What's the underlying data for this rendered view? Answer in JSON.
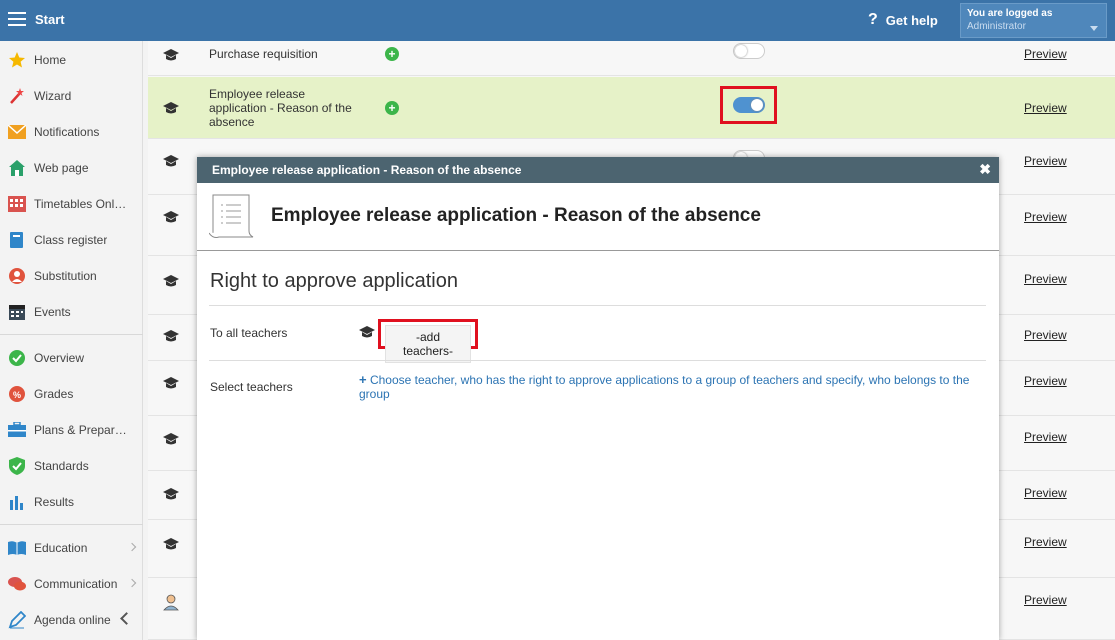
{
  "topbar": {
    "start_label": "Start",
    "help_label": "Get help",
    "login_line1": "You are logged as",
    "login_user": "Administrator"
  },
  "sidebar": {
    "items": [
      {
        "label": "Home",
        "icon": "star-icon"
      },
      {
        "label": "Wizard",
        "icon": "wand-icon"
      },
      {
        "label": "Notifications",
        "icon": "envelope-icon"
      },
      {
        "label": "Web page",
        "icon": "house-icon"
      },
      {
        "label": "Timetables Onl…",
        "icon": "timetable-icon"
      },
      {
        "label": "Class register",
        "icon": "book-icon"
      },
      {
        "label": "Substitution",
        "icon": "person-icon"
      },
      {
        "label": "Events",
        "icon": "calendar-icon"
      },
      {
        "label": "Overview",
        "icon": "check-circle-icon"
      },
      {
        "label": "Grades",
        "icon": "grades-icon"
      },
      {
        "label": "Plans & Prepar…",
        "icon": "briefcase-icon"
      },
      {
        "label": "Standards",
        "icon": "shield-icon"
      },
      {
        "label": "Results",
        "icon": "bar-chart-icon"
      },
      {
        "label": "Education",
        "icon": "open-book-icon"
      },
      {
        "label": "Communication",
        "icon": "chat-icon"
      },
      {
        "label": "Agenda online",
        "icon": "pen-icon"
      }
    ]
  },
  "list": {
    "preview_label": "Preview",
    "rows": [
      {
        "label": "Purchase requisition",
        "toggle": "off"
      },
      {
        "label": "Employee release application - Reason of the absence",
        "toggle": "on"
      }
    ]
  },
  "modal": {
    "header": "Employee release application - Reason of the absence",
    "title": "Employee release application - Reason of the absence",
    "section_title": "Right to approve application",
    "field1_label": "To all teachers",
    "add_teachers": "-add teachers-",
    "field2_label": "Select teachers",
    "choose_link": "Choose teacher, who has the right to approve applications to a group of teachers and specify, who belongs to the group"
  },
  "colors": {
    "topbar": "#3b73a8",
    "highlight_row": "#e6f2c8",
    "modal_header": "#4c6470",
    "red_annotation": "#e0101f",
    "link_blue": "#2c74b3",
    "toggle_on": "#4f92d0"
  }
}
